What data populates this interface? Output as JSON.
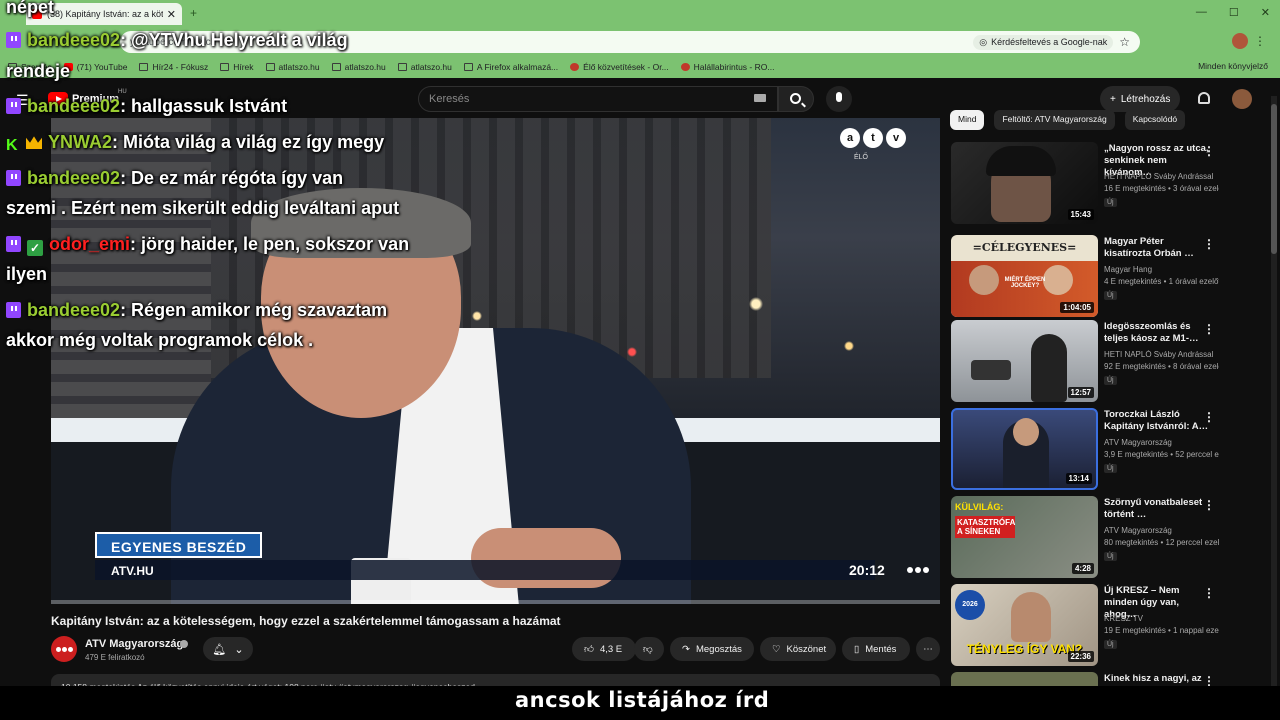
{
  "browser": {
    "tab_title": "(38) Kapitány István: az a kötelességem",
    "new_tab": "+",
    "window_controls": [
      "—",
      "☐",
      "✕"
    ],
    "url": "youtube.com/watch",
    "google_search_label": "Kérdésfeltevés a Google-nak",
    "bookmarks": [
      {
        "icon": "folder-icon",
        "label": "Szerzés"
      },
      {
        "icon": "youtube-icon",
        "label": "(71) YouTube"
      },
      {
        "icon": "folder-icon",
        "label": "Hír24 - Fókusz"
      },
      {
        "icon": "folder-icon",
        "label": "Hírek"
      },
      {
        "icon": "folder-icon",
        "label": "atlatszo.hu"
      },
      {
        "icon": "folder-icon",
        "label": "atlatszo.hu"
      },
      {
        "icon": "folder-icon",
        "label": "atlatszo.hu"
      },
      {
        "icon": "folder-icon",
        "label": "A Firefox alkalmazá..."
      },
      {
        "icon": "live-icon",
        "label": "Élő közvetítések - Or..."
      },
      {
        "icon": "red-dot-icon",
        "label": "Halállabirintus - RO..."
      }
    ],
    "bookmarks_right": "Minden könyvjelző"
  },
  "youtube": {
    "premium_label": "Premium",
    "region": "HU",
    "search_placeholder": "Keresés",
    "create_label": "Létrehozás"
  },
  "player": {
    "logo_letters": [
      "a",
      "t",
      "v"
    ],
    "live_label": "ÉLŐ",
    "show_name": "EGYENES BESZÉD",
    "site": "ATV.HU",
    "clock": "20:12",
    "progress": 0.0
  },
  "video": {
    "title": "Kapitány István: az a kötelességem, hogy ezzel a szakértelemmel támogassam a hazámat",
    "channel": "ATV Magyarország",
    "subscribers": "479 E feliratkozó",
    "likes": "4,3 E",
    "share_label": "Megosztás",
    "thanks_label": "Köszönet",
    "save_label": "Mentés",
    "description_preview": "10 158 megtekintés  Az élő közvetítés ennyi ideje ért véget: 108 perc  #atv #atvmagyarorszag #egyenesbeszed"
  },
  "chips": [
    {
      "label": "Mind",
      "active": true
    },
    {
      "label": "Feltöltő: ATV Magyarország",
      "active": false
    },
    {
      "label": "Kapcsolódó",
      "active": false
    }
  ],
  "suggestions": [
    {
      "title": "„Nagyon rossz az utca, senkinek nem kívánom…",
      "channel": "HETI NAPLÓ Sváby Andrással",
      "stats": "16 E megtekintés • 3 órával ezelőtt",
      "badge": "Új",
      "duration": "15:43"
    },
    {
      "title": "Magyar Péter kisatírozta Orbán …",
      "channel": "Magyar Hang",
      "stats": "4 E megtekintés • 1 órával ezelőtt",
      "badge": "Új",
      "duration": "1:04:05"
    },
    {
      "title": "Idegösszeomlás és teljes káosz az M1-…",
      "channel": "HETI NAPLÓ Sváby Andrással",
      "stats": "92 E megtekintés • 8 órával ezelőtt",
      "badge": "Új",
      "duration": "12:57"
    },
    {
      "title": "Toroczkai László Kapitány Istvánról: A…",
      "channel": "ATV Magyarország",
      "stats": "3,9 E megtekintés • 52 perccel ezelőtt",
      "badge": "Új",
      "duration": "13:14"
    },
    {
      "title": "Szörnyű vonatbaleset történt …",
      "channel": "ATV Magyarország",
      "stats": "80 megtekintés • 12 perccel ezelőtt",
      "badge": "Új",
      "duration": "4:28"
    },
    {
      "title": "Új KRESZ – Nem minden úgy van, ahog…",
      "channel": "KRESZ TV",
      "stats": "19 E megtekintés • 1 nappal ezelőtt",
      "badge": "Új",
      "duration": "22:36"
    },
    {
      "title": "Kinek hisz a nagyi, az",
      "channel": "",
      "stats": "",
      "badge": "",
      "duration": ""
    }
  ],
  "thumb_texts": {
    "celegyenes": "=CÉLEGYENES=",
    "celegyenes_sub": "MIÉRT ÉPPEN JOCKEY?",
    "kulvilag": "KÜLVILÁG:",
    "katasztrofa": "KATASZTRÓFA A SÍNEKEN",
    "tenyleg": "TÉNYLEG ÍGY VAN?",
    "year_badge": "2026"
  },
  "chat": [
    {
      "badge": "twitch",
      "user": "",
      "user_color": "#ffffff",
      "text": "népet"
    },
    {
      "badge": "twitch",
      "user": "bandeee02",
      "user_color": "#9acd32",
      "text": ": @YTVhu Helyreált a világ"
    },
    {
      "badge": "",
      "user": "",
      "user_color": "#ffffff",
      "text": "rendeje"
    },
    {
      "badge": "twitch",
      "user": "bandeee02",
      "user_color": "#9acd32",
      "text": ": hallgassuk Istvánt"
    },
    {
      "badge": "kick",
      "user": "YNWA2",
      "user_color": "#9acd32",
      "text": ": Mióta világ a világ ez így megy"
    },
    {
      "badge": "twitch",
      "user": "bandeee02",
      "user_color": "#9acd32",
      "text": ": De ez már régóta így van"
    },
    {
      "badge": "",
      "user": "",
      "user_color": "#ffffff",
      "text": "szemi . Ezért nem sikerült eddig leváltani aput"
    },
    {
      "badge": "twitch-mod",
      "user": "odor_emi",
      "user_color": "#ff2020",
      "text": ": jörg haider, le pen, sokszor van"
    },
    {
      "badge": "",
      "user": "",
      "user_color": "#ffffff",
      "text": "ilyen"
    },
    {
      "badge": "twitch",
      "user": "bandeee02",
      "user_color": "#9acd32",
      "text": ": Régen amikor még szavaztam"
    },
    {
      "badge": "",
      "user": "",
      "user_color": "#ffffff",
      "text": "akkor még voltak programok célok ."
    }
  ],
  "subtitle": "ancsok listájához írd"
}
